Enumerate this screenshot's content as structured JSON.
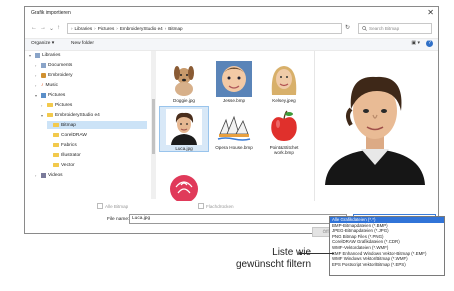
{
  "dialog": {
    "title": "Grafik importieren",
    "close": "✕"
  },
  "nav": {
    "back": "←",
    "forward": "→",
    "down": "⌄",
    "up": "↑",
    "breadcrumb": [
      "Libraries",
      "Pictures",
      "EmbroideryStudio e4",
      "Bitmap"
    ],
    "separator": "›",
    "refresh": "↻",
    "search_placeholder": "Search Bitmap"
  },
  "toolbar": {
    "organize": "Organize ▾",
    "new_folder": "New folder",
    "view": "▣ ▾",
    "help": "?"
  },
  "tree": {
    "items": [
      {
        "label": "Libraries",
        "icon": "library-icon",
        "chevron": "▾"
      },
      {
        "label": "Documents",
        "icon": "library-icon",
        "chevron": "›"
      },
      {
        "label": "Embroidery",
        "icon": "library-icon",
        "chevron": "›"
      },
      {
        "label": "Music",
        "icon": "music-icon",
        "chevron": "›"
      },
      {
        "label": "Pictures",
        "icon": "library-icon",
        "chevron": "▾"
      },
      {
        "label": "Pictures",
        "icon": "folder-icon",
        "chevron": "›"
      },
      {
        "label": "EmbroideryStudio e4",
        "icon": "folder-icon",
        "chevron": "▾"
      },
      {
        "label": "Bitmap",
        "icon": "folder-icon",
        "chevron": ""
      },
      {
        "label": "CorelDRAW",
        "icon": "folder-icon",
        "chevron": ""
      },
      {
        "label": "Fabrics",
        "icon": "folder-icon",
        "chevron": ""
      },
      {
        "label": "Illustrator",
        "icon": "folder-icon",
        "chevron": ""
      },
      {
        "label": "Vector",
        "icon": "folder-icon",
        "chevron": ""
      },
      {
        "label": "Videos",
        "icon": "video-icon",
        "chevron": "›"
      }
    ]
  },
  "files": [
    {
      "name": "Doggie.jpg",
      "thumb": "dog"
    },
    {
      "name": "Jesse.bmp",
      "thumb": "baby"
    },
    {
      "name": "Kelsey.jpeg",
      "thumb": "girl"
    },
    {
      "name": "Luca.jpg",
      "thumb": "boy"
    },
    {
      "name": "Opera House.bmp",
      "thumb": "opera"
    },
    {
      "name": "Point&Stitchet work.bmp",
      "thumb": "apple"
    },
    {
      "name": "",
      "thumb": "rose"
    }
  ],
  "options": {
    "all_bitmap": "Alle Bitmap",
    "flatten": "Flachdrücken"
  },
  "filename": {
    "label": "File name:",
    "value": "Luca.jpg"
  },
  "filter": {
    "selected": "Alle Grafikdateien (*.*)",
    "arrow": "⌄",
    "options": [
      "Alle Grafikdateien (*.*)",
      "BMP-Bitmapdateien (*.BMP)",
      "JPEG-Bitmapdateien (*.JPG)",
      "PNG Bitmap Files (*.PNG)",
      "CorelDRAW Grafikdateien (*.CDR)",
      "WMF-Vektordateien (*.WMF)",
      "EMF Enhanced Windows Vektor-Bitmap (*.EMF)",
      "WMF Windows Vektor/Bitmap (*.WMF)",
      "EPS Postscript Vektor/Bitmap (*.EPS)"
    ]
  },
  "open_button": "Öffnen ...",
  "callout": {
    "line1": "Liste wie",
    "line2": "gewünscht filtern"
  },
  "colors": {
    "selection": "#3174d8",
    "folder": "#f2c94c",
    "apple": "#e0302c",
    "rose": "#e03a5a"
  }
}
